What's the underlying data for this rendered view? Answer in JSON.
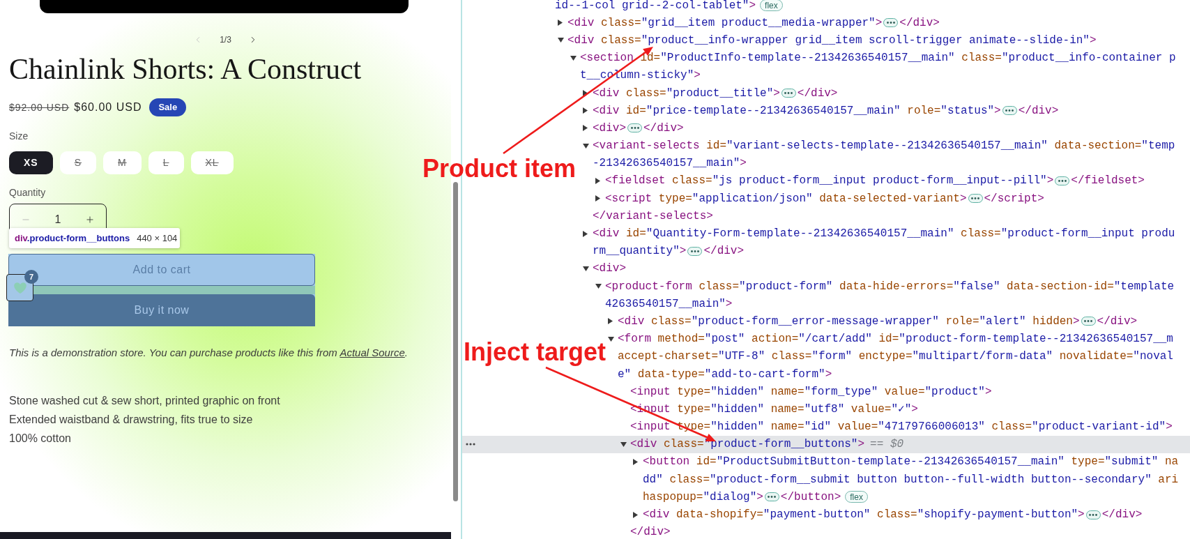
{
  "product_page": {
    "carousel": {
      "counter": "1/3",
      "previous": {
        "disabled": true
      },
      "next": {
        "disabled": false
      }
    },
    "title": "Chainlink Shorts: A Construct",
    "price": {
      "regular": "$92.00 USD",
      "sale": "$60.00 USD",
      "badge": "Sale"
    },
    "size": {
      "label": "Size",
      "options": [
        {
          "label": "XS",
          "selected": true,
          "available": true
        },
        {
          "label": "S",
          "selected": false,
          "available": false
        },
        {
          "label": "M",
          "selected": false,
          "available": false
        },
        {
          "label": "L",
          "selected": false,
          "available": false
        },
        {
          "label": "XL",
          "selected": false,
          "available": false
        }
      ]
    },
    "quantity": {
      "label": "Quantity",
      "value": "1",
      "decrease": {
        "disabled": true
      },
      "increase": {
        "disabled": false
      }
    },
    "buttons": {
      "add_to_cart": "Add to cart",
      "buy_now": "Buy it now"
    },
    "wishlist": {
      "count": "7"
    },
    "demo_note": {
      "before": "This is a demonstration store. You can purchase products like this from ",
      "link": "Actual Source",
      "after": "."
    },
    "description": [
      "Stone washed cut & sew short, printed graphic on front",
      "Extended waistband & drawstring, fits true to size",
      "100% cotton"
    ]
  },
  "inspector_tooltip": {
    "tag": "div",
    "selector": ".product-form__buttons",
    "size": "440 × 104"
  },
  "devtools": {
    "dom_tree": {
      "selected": false,
      "badge": "flex",
      "lines": [
        [
          {
            "kind": "value",
            "text": "id--1-col grid--2-col-tablet\""
          },
          {
            "kind": "tag",
            "text": ">"
          }
        ]
      ],
      "children": [
        {
          "expanded": false,
          "selected": false,
          "lines": [
            [
              {
                "kind": "tag",
                "text": "<div"
              },
              {
                "kind": "attr",
                "text": " class="
              },
              {
                "kind": "value",
                "text": "\"grid__item product__media-wrapper\""
              },
              {
                "kind": "tag",
                "text": ">"
              }
            ]
          ],
          "close": [
            {
              "kind": "tag",
              "text": "</div>"
            }
          ]
        },
        {
          "expanded": true,
          "selected": false,
          "lines": [
            [
              {
                "kind": "tag",
                "text": "<div"
              },
              {
                "kind": "attr",
                "text": " class="
              },
              {
                "kind": "value",
                "text": "\"product__info-wrapper grid__item scroll-trigger animate--slide-in\""
              },
              {
                "kind": "tag",
                "text": ">"
              }
            ]
          ],
          "children": [
            {
              "expanded": true,
              "selected": false,
              "lines": [
                [
                  {
                    "kind": "tag",
                    "text": "<section"
                  },
                  {
                    "kind": "attr",
                    "text": " id="
                  },
                  {
                    "kind": "value",
                    "text": "\"ProductInfo-template--21342636540157__main\""
                  },
                  {
                    "kind": "attr",
                    "text": " class="
                  },
                  {
                    "kind": "value",
                    "text": "\"product__info-container p"
                  }
                ],
                [
                  {
                    "kind": "value",
                    "text": "t__column-sticky\""
                  },
                  {
                    "kind": "tag",
                    "text": ">"
                  }
                ]
              ],
              "children": [
                {
                  "expanded": false,
                  "selected": false,
                  "lines": [
                    [
                      {
                        "kind": "tag",
                        "text": "<div"
                      },
                      {
                        "kind": "attr",
                        "text": " class="
                      },
                      {
                        "kind": "value",
                        "text": "\"product__title\""
                      },
                      {
                        "kind": "tag",
                        "text": ">"
                      }
                    ]
                  ],
                  "close": [
                    {
                      "kind": "tag",
                      "text": "</div>"
                    }
                  ]
                },
                {
                  "expanded": false,
                  "selected": false,
                  "lines": [
                    [
                      {
                        "kind": "tag",
                        "text": "<div"
                      },
                      {
                        "kind": "attr",
                        "text": " id="
                      },
                      {
                        "kind": "value",
                        "text": "\"price-template--21342636540157__main\""
                      },
                      {
                        "kind": "attr",
                        "text": " role="
                      },
                      {
                        "kind": "value",
                        "text": "\"status\""
                      },
                      {
                        "kind": "tag",
                        "text": ">"
                      }
                    ]
                  ],
                  "close": [
                    {
                      "kind": "tag",
                      "text": "</div>"
                    }
                  ]
                },
                {
                  "expanded": false,
                  "selected": false,
                  "lines": [
                    [
                      {
                        "kind": "tag",
                        "text": "<div>"
                      }
                    ]
                  ],
                  "close": [
                    {
                      "kind": "tag",
                      "text": "</div>"
                    }
                  ]
                },
                {
                  "expanded": true,
                  "selected": false,
                  "lines": [
                    [
                      {
                        "kind": "tag",
                        "text": "<variant-selects"
                      },
                      {
                        "kind": "attr",
                        "text": " id="
                      },
                      {
                        "kind": "value",
                        "text": "\"variant-selects-template--21342636540157__main\""
                      },
                      {
                        "kind": "attr",
                        "text": " data-section="
                      },
                      {
                        "kind": "value",
                        "text": "\"temp"
                      }
                    ],
                    [
                      {
                        "kind": "value",
                        "text": "-21342636540157__main\""
                      },
                      {
                        "kind": "tag",
                        "text": ">"
                      }
                    ]
                  ],
                  "children": [
                    {
                      "expanded": false,
                      "selected": false,
                      "lines": [
                        [
                          {
                            "kind": "tag",
                            "text": "<fieldset"
                          },
                          {
                            "kind": "attr",
                            "text": " class="
                          },
                          {
                            "kind": "value",
                            "text": "\"js product-form__input product-form__input--pill\""
                          },
                          {
                            "kind": "tag",
                            "text": ">"
                          }
                        ]
                      ],
                      "close": [
                        {
                          "kind": "tag",
                          "text": "</fieldset>"
                        }
                      ]
                    },
                    {
                      "expanded": false,
                      "selected": false,
                      "lines": [
                        [
                          {
                            "kind": "tag",
                            "text": "<script"
                          },
                          {
                            "kind": "attr",
                            "text": " type="
                          },
                          {
                            "kind": "value",
                            "text": "\"application/json\""
                          },
                          {
                            "kind": "attr",
                            "text": " data-selected-variant"
                          },
                          {
                            "kind": "tag",
                            "text": ">"
                          }
                        ]
                      ],
                      "close": [
                        {
                          "kind": "tag",
                          "text": "</script>"
                        }
                      ]
                    }
                  ],
                  "close": [
                    {
                      "kind": "tag",
                      "text": "</variant-selects>"
                    }
                  ]
                },
                {
                  "expanded": false,
                  "selected": false,
                  "lines": [
                    [
                      {
                        "kind": "tag",
                        "text": "<div"
                      },
                      {
                        "kind": "attr",
                        "text": " id="
                      },
                      {
                        "kind": "value",
                        "text": "\"Quantity-Form-template--21342636540157__main\""
                      },
                      {
                        "kind": "attr",
                        "text": " class="
                      },
                      {
                        "kind": "value",
                        "text": "\"product-form__input produ"
                      }
                    ],
                    [
                      {
                        "kind": "value",
                        "text": "rm__quantity\""
                      },
                      {
                        "kind": "tag",
                        "text": ">"
                      }
                    ]
                  ],
                  "close": [
                    {
                      "kind": "tag",
                      "text": "</div>"
                    }
                  ]
                },
                {
                  "expanded": true,
                  "selected": false,
                  "lines": [
                    [
                      {
                        "kind": "tag",
                        "text": "<div>"
                      }
                    ]
                  ],
                  "children": [
                    {
                      "expanded": true,
                      "selected": false,
                      "lines": [
                        [
                          {
                            "kind": "tag",
                            "text": "<product-form"
                          },
                          {
                            "kind": "attr",
                            "text": " class="
                          },
                          {
                            "kind": "value",
                            "text": "\"product-form\""
                          },
                          {
                            "kind": "attr",
                            "text": " data-hide-errors="
                          },
                          {
                            "kind": "value",
                            "text": "\"false\""
                          },
                          {
                            "kind": "attr",
                            "text": " data-section-id="
                          },
                          {
                            "kind": "value",
                            "text": "\"template"
                          }
                        ],
                        [
                          {
                            "kind": "value",
                            "text": "42636540157__main\""
                          },
                          {
                            "kind": "tag",
                            "text": ">"
                          }
                        ]
                      ],
                      "children": [
                        {
                          "expanded": false,
                          "selected": false,
                          "lines": [
                            [
                              {
                                "kind": "tag",
                                "text": "<div"
                              },
                              {
                                "kind": "attr",
                                "text": " class="
                              },
                              {
                                "kind": "value",
                                "text": "\"product-form__error-message-wrapper\""
                              },
                              {
                                "kind": "attr",
                                "text": " role="
                              },
                              {
                                "kind": "value",
                                "text": "\"alert\""
                              },
                              {
                                "kind": "attr",
                                "text": " hidden"
                              },
                              {
                                "kind": "tag",
                                "text": ">"
                              }
                            ]
                          ],
                          "close": [
                            {
                              "kind": "tag",
                              "text": "</div>"
                            }
                          ]
                        },
                        {
                          "expanded": true,
                          "selected": false,
                          "lines": [
                            [
                              {
                                "kind": "tag",
                                "text": "<form"
                              },
                              {
                                "kind": "attr",
                                "text": " method="
                              },
                              {
                                "kind": "value",
                                "text": "\"post\""
                              },
                              {
                                "kind": "attr",
                                "text": " action="
                              },
                              {
                                "kind": "value",
                                "text": "\"/cart/add\""
                              },
                              {
                                "kind": "attr",
                                "text": " id="
                              },
                              {
                                "kind": "value",
                                "text": "\"product-form-template--21342636540157__m"
                              }
                            ],
                            [
                              {
                                "kind": "attr",
                                "text": "accept-charset="
                              },
                              {
                                "kind": "value",
                                "text": "\"UTF-8\""
                              },
                              {
                                "kind": "attr",
                                "text": " class="
                              },
                              {
                                "kind": "value",
                                "text": "\"form\""
                              },
                              {
                                "kind": "attr",
                                "text": " enctype="
                              },
                              {
                                "kind": "value",
                                "text": "\"multipart/form-data\""
                              },
                              {
                                "kind": "attr",
                                "text": " novalidate="
                              },
                              {
                                "kind": "value",
                                "text": "\"noval"
                              }
                            ],
                            [
                              {
                                "kind": "value",
                                "text": "e\""
                              },
                              {
                                "kind": "attr",
                                "text": " data-type="
                              },
                              {
                                "kind": "value",
                                "text": "\"add-to-cart-form\""
                              },
                              {
                                "kind": "tag",
                                "text": ">"
                              }
                            ]
                          ],
                          "children": [
                            {
                              "selected": false,
                              "lines": [
                                [
                                  {
                                    "kind": "tag",
                                    "text": "<input"
                                  },
                                  {
                                    "kind": "attr",
                                    "text": " type="
                                  },
                                  {
                                    "kind": "value",
                                    "text": "\"hidden\""
                                  },
                                  {
                                    "kind": "attr",
                                    "text": " name="
                                  },
                                  {
                                    "kind": "value",
                                    "text": "\"form_type\""
                                  },
                                  {
                                    "kind": "attr",
                                    "text": " value="
                                  },
                                  {
                                    "kind": "value",
                                    "text": "\"product\""
                                  },
                                  {
                                    "kind": "tag",
                                    "text": ">"
                                  }
                                ]
                              ]
                            },
                            {
                              "selected": false,
                              "lines": [
                                [
                                  {
                                    "kind": "tag",
                                    "text": "<input"
                                  },
                                  {
                                    "kind": "attr",
                                    "text": " type="
                                  },
                                  {
                                    "kind": "value",
                                    "text": "\"hidden\""
                                  },
                                  {
                                    "kind": "attr",
                                    "text": " name="
                                  },
                                  {
                                    "kind": "value",
                                    "text": "\"utf8\""
                                  },
                                  {
                                    "kind": "attr",
                                    "text": " value="
                                  },
                                  {
                                    "kind": "value",
                                    "text": "\"✓\""
                                  },
                                  {
                                    "kind": "tag",
                                    "text": ">"
                                  }
                                ]
                              ]
                            },
                            {
                              "selected": false,
                              "lines": [
                                [
                                  {
                                    "kind": "tag",
                                    "text": "<input"
                                  },
                                  {
                                    "kind": "attr",
                                    "text": " type="
                                  },
                                  {
                                    "kind": "value",
                                    "text": "\"hidden\""
                                  },
                                  {
                                    "kind": "attr",
                                    "text": " name="
                                  },
                                  {
                                    "kind": "value",
                                    "text": "\"id\""
                                  },
                                  {
                                    "kind": "attr",
                                    "text": " value="
                                  },
                                  {
                                    "kind": "value",
                                    "text": "\"47179766006013\""
                                  },
                                  {
                                    "kind": "attr",
                                    "text": " class="
                                  },
                                  {
                                    "kind": "value",
                                    "text": "\"product-variant-id\""
                                  },
                                  {
                                    "kind": "tag",
                                    "text": ">"
                                  }
                                ]
                              ]
                            },
                            {
                              "expanded": true,
                              "selected": true,
                              "note": "== $0",
                              "lines": [
                                [
                                  {
                                    "kind": "tag",
                                    "text": "<div"
                                  },
                                  {
                                    "kind": "attr",
                                    "text": " class="
                                  },
                                  {
                                    "kind": "value",
                                    "text": "\"product-form__buttons\""
                                  },
                                  {
                                    "kind": "tag",
                                    "text": ">"
                                  }
                                ]
                              ],
                              "children": [
                                {
                                  "expanded": false,
                                  "selected": false,
                                  "badge": "flex",
                                  "lines": [
                                    [
                                      {
                                        "kind": "tag",
                                        "text": "<button"
                                      },
                                      {
                                        "kind": "attr",
                                        "text": " id="
                                      },
                                      {
                                        "kind": "value",
                                        "text": "\"ProductSubmitButton-template--21342636540157__main\""
                                      },
                                      {
                                        "kind": "attr",
                                        "text": " type="
                                      },
                                      {
                                        "kind": "value",
                                        "text": "\"submit\""
                                      },
                                      {
                                        "kind": "attr",
                                        "text": " na"
                                      }
                                    ],
                                    [
                                      {
                                        "kind": "value",
                                        "text": "dd\""
                                      },
                                      {
                                        "kind": "attr",
                                        "text": " class="
                                      },
                                      {
                                        "kind": "value",
                                        "text": "\"product-form__submit button button--full-width button--secondary\""
                                      },
                                      {
                                        "kind": "attr",
                                        "text": " ari"
                                      }
                                    ],
                                    [
                                      {
                                        "kind": "attr",
                                        "text": "haspopup="
                                      },
                                      {
                                        "kind": "value",
                                        "text": "\"dialog\""
                                      },
                                      {
                                        "kind": "tag",
                                        "text": ">"
                                      }
                                    ]
                                  ],
                                  "close": [
                                    {
                                      "kind": "tag",
                                      "text": "</button>"
                                    }
                                  ]
                                },
                                {
                                  "expanded": false,
                                  "selected": false,
                                  "lines": [
                                    [
                                      {
                                        "kind": "tag",
                                        "text": "<div"
                                      },
                                      {
                                        "kind": "attr",
                                        "text": " data-shopify="
                                      },
                                      {
                                        "kind": "value",
                                        "text": "\"payment-button\""
                                      },
                                      {
                                        "kind": "attr",
                                        "text": " class="
                                      },
                                      {
                                        "kind": "value",
                                        "text": "\"shopify-payment-button\""
                                      },
                                      {
                                        "kind": "tag",
                                        "text": ">"
                                      }
                                    ]
                                  ],
                                  "close": [
                                    {
                                      "kind": "tag",
                                      "text": "</div>"
                                    }
                                  ]
                                }
                              ],
                              "close": [
                                {
                                  "kind": "tag",
                                  "text": "</div>"
                                }
                              ]
                            }
                          ]
                        }
                      ]
                    }
                  ]
                }
              ]
            }
          ]
        }
      ]
    }
  },
  "annotations": [
    {
      "text": "Product item"
    },
    {
      "text": "Inject target"
    }
  ]
}
